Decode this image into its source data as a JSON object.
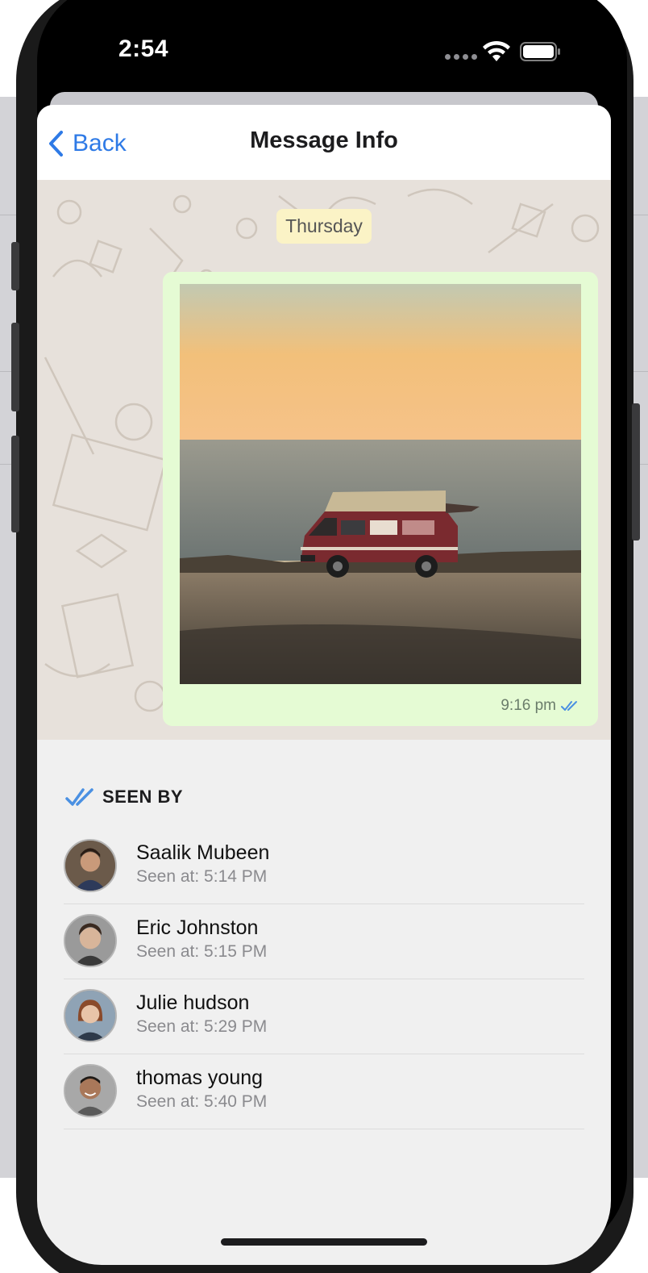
{
  "status_bar": {
    "time": "2:54"
  },
  "nav": {
    "back_label": "Back",
    "title": "Message Info"
  },
  "chat": {
    "day_label": "Thursday",
    "message": {
      "time": "9:16 pm",
      "status_icon": "double-check-icon"
    }
  },
  "seen_by": {
    "title": "SEEN BY",
    "people": [
      {
        "name": "Saalik Mubeen",
        "seen": "Seen at: 5:14 PM"
      },
      {
        "name": "Eric Johnston",
        "seen": "Seen at: 5:15 PM"
      },
      {
        "name": "Julie hudson",
        "seen": "Seen at: 5:29 PM"
      },
      {
        "name": "thomas young",
        "seen": "Seen at: 5:40 PM"
      }
    ]
  },
  "colors": {
    "accent": "#2e7ae6",
    "bubble": "#e5fbd4",
    "chip": "#fbf3c6",
    "check": "#4a90e2"
  }
}
